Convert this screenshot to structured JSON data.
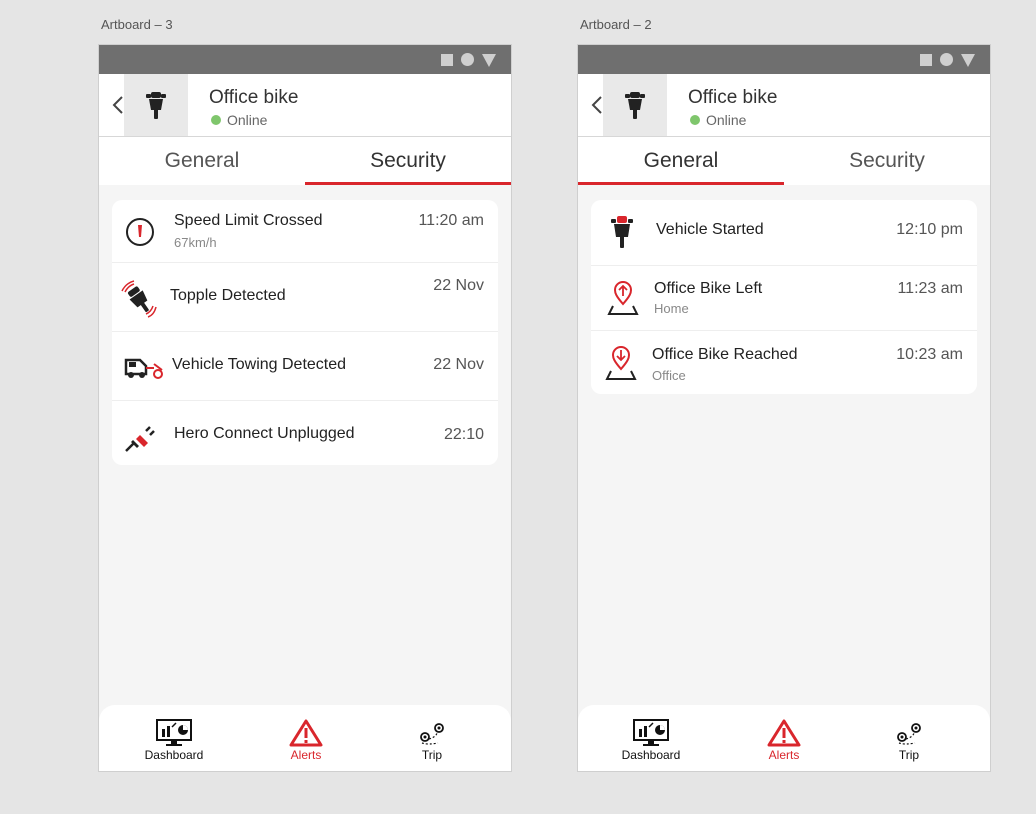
{
  "artboards": [
    {
      "label": "Artboard – 3",
      "vehicle": {
        "name": "Office bike",
        "status": "Online"
      },
      "tabs": [
        {
          "label": "General"
        },
        {
          "label": "Security"
        }
      ],
      "active_tab": "Security",
      "alerts": [
        {
          "title": "Speed Limit Crossed",
          "subtitle": "67km/h",
          "time": "11:20 am",
          "icon": "speedometer-icon"
        },
        {
          "title": "Topple Detected",
          "subtitle": "",
          "time": "22 Nov",
          "icon": "topple-icon"
        },
        {
          "title": "Vehicle Towing Detected",
          "subtitle": "",
          "time": "22 Nov",
          "icon": "tow-truck-icon"
        },
        {
          "title": "Hero Connect Unplugged",
          "subtitle": "",
          "time": "22:10",
          "icon": "unplug-icon"
        }
      ]
    },
    {
      "label": "Artboard – 2",
      "vehicle": {
        "name": "Office bike",
        "status": "Online"
      },
      "tabs": [
        {
          "label": "General"
        },
        {
          "label": "Security"
        }
      ],
      "active_tab": "General",
      "alerts": [
        {
          "title": "Vehicle Started",
          "subtitle": "",
          "time": "12:10 pm",
          "icon": "motorbike-icon"
        },
        {
          "title": "Office Bike Left",
          "subtitle": "Home",
          "time": "11:23 am",
          "icon": "location-up-icon"
        },
        {
          "title": "Office Bike Reached",
          "subtitle": "Office",
          "time": "10:23 am",
          "icon": "location-down-icon"
        }
      ]
    }
  ],
  "bottom_nav": [
    {
      "label": "Dashboard",
      "icon": "dashboard-icon"
    },
    {
      "label": "Alerts",
      "icon": "alert-triangle-icon",
      "active": true
    },
    {
      "label": "Trip",
      "icon": "trip-icon"
    }
  ],
  "colors": {
    "accent": "#d9262c",
    "online": "#7fc66c",
    "statusbar": "#6f6f6f"
  }
}
